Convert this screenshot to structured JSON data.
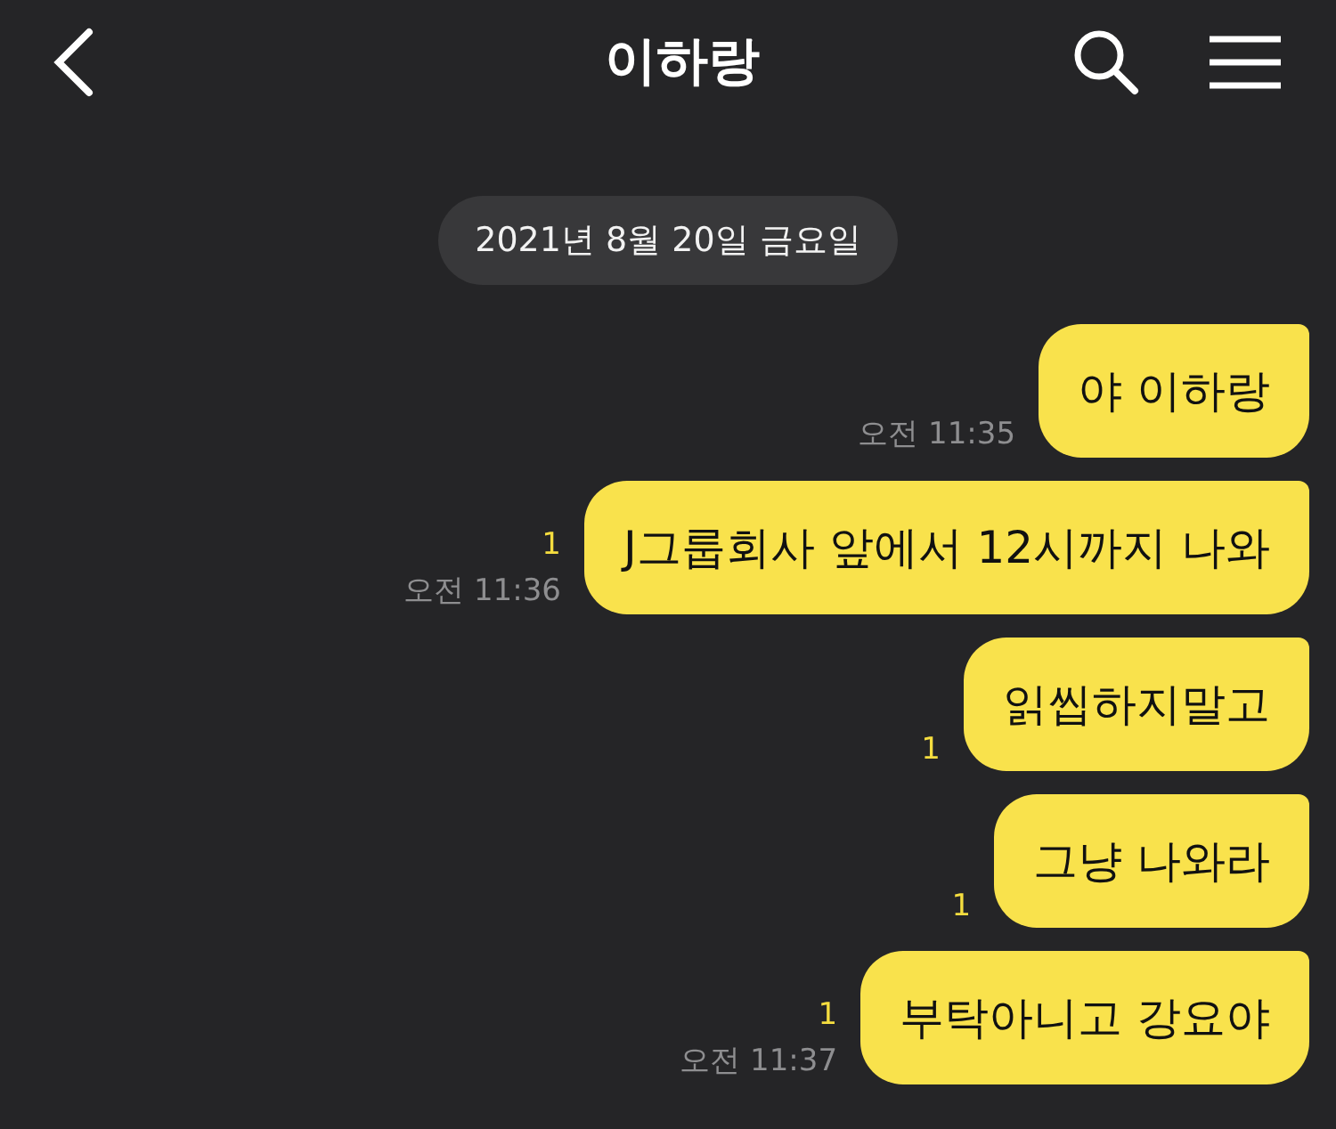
{
  "header": {
    "title": "이하랑"
  },
  "date_divider": "2021년 8월 20일 금요일",
  "messages": [
    {
      "text": "야 이하랑",
      "time": "오전 11:35"
    },
    {
      "text": "J그룹회사 앞에서 12시까지 나와",
      "unread": "1",
      "time": "오전 11:36"
    },
    {
      "text": "읽씹하지말고",
      "unread": "1"
    },
    {
      "text": "그냥 나와라",
      "unread": "1"
    },
    {
      "text": "부탁아니고 강요야",
      "unread": "1",
      "time": "오전 11:37"
    }
  ]
}
